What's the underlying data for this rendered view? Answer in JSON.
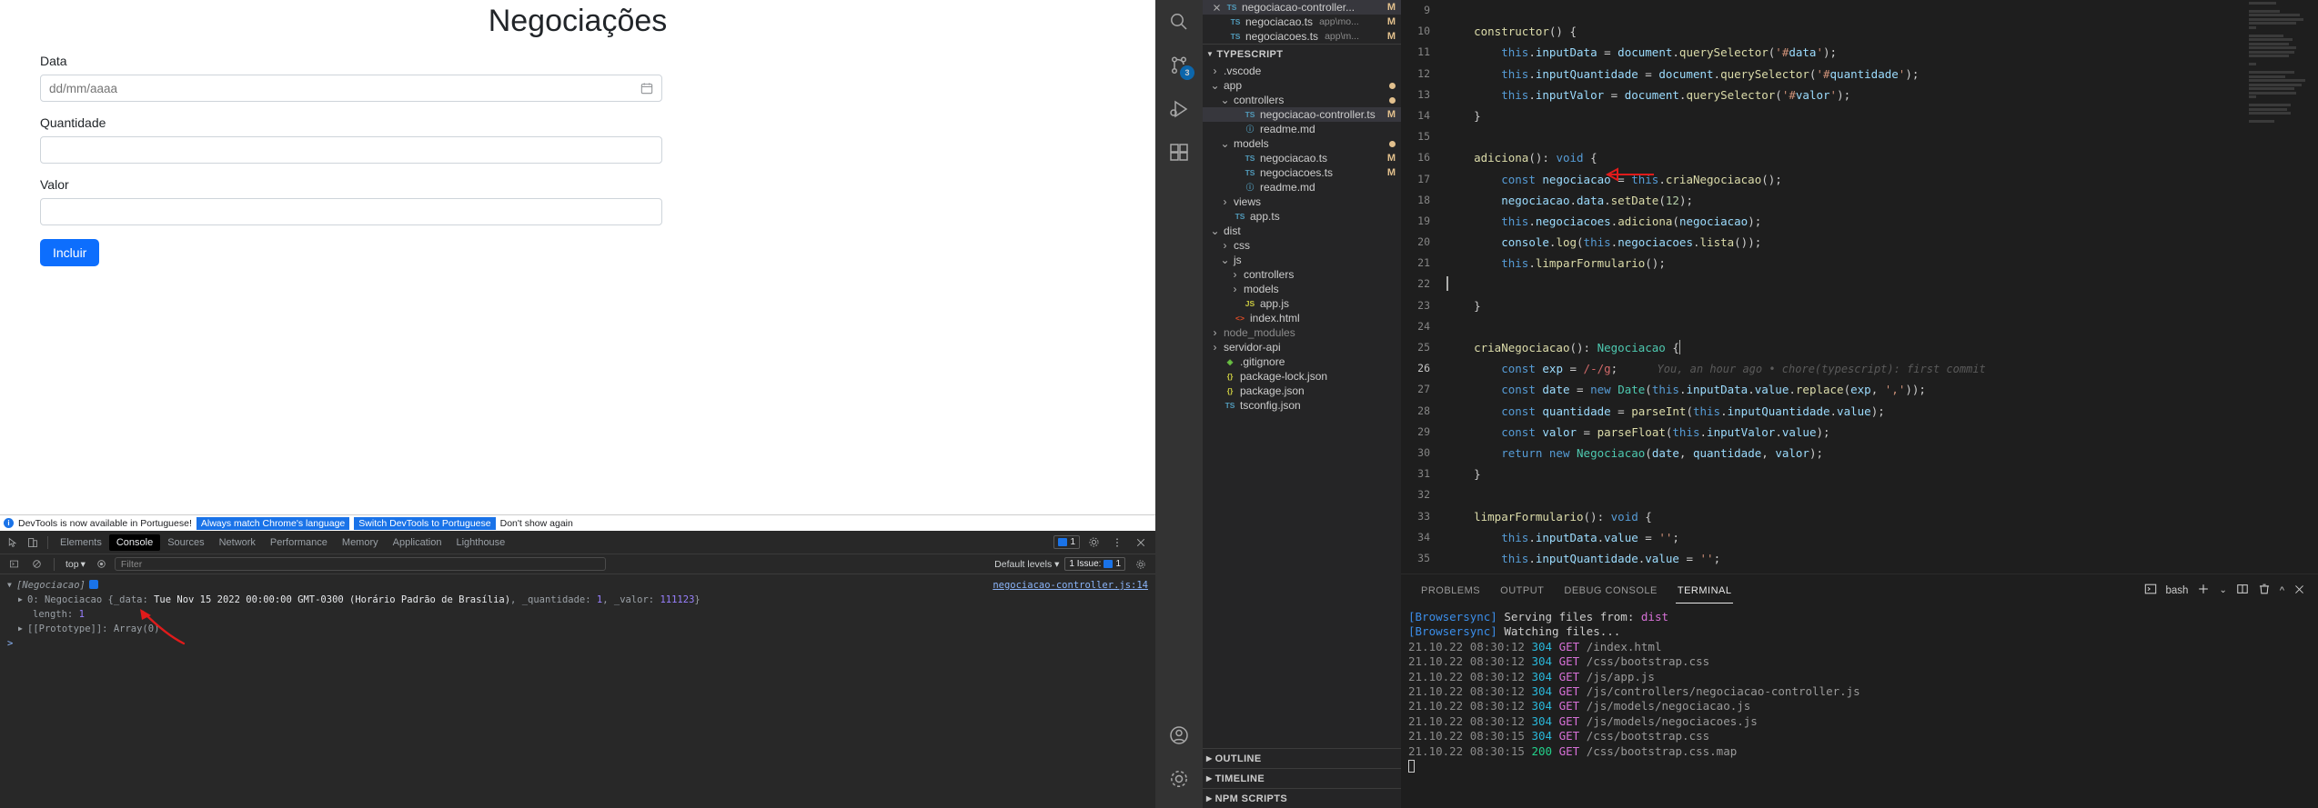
{
  "browser": {
    "page": {
      "title": "Negociações",
      "fields": [
        {
          "label": "Data",
          "placeholder": "dd/mm/aaaa",
          "value": "",
          "icon": "calendar-icon"
        },
        {
          "label": "Quantidade",
          "placeholder": "",
          "value": "",
          "icon": ""
        },
        {
          "label": "Valor",
          "placeholder": "",
          "value": "",
          "icon": ""
        }
      ],
      "submit_label": "Incluir",
      "accent_color": "#0d6efd"
    },
    "devtools_banner": {
      "message": "DevTools is now available in Portuguese!",
      "buttons": [
        "Always match Chrome's language",
        "Switch DevTools to Portuguese"
      ],
      "dismiss": "Don't show again"
    },
    "devtools": {
      "tabs": [
        "Elements",
        "Console",
        "Sources",
        "Network",
        "Performance",
        "Memory",
        "Application",
        "Lighthouse"
      ],
      "active_tab": "Console",
      "top_right_badge_count": "1",
      "filterbar": {
        "context": "top",
        "filter_placeholder": "Filter",
        "levels": "Default levels",
        "issues_label": "1 Issue:",
        "issues_count": "1"
      },
      "console": {
        "array_label": "[Negociacao]",
        "entry_index": "0:",
        "entry_class": "Negociacao",
        "entry_body": "{_data: Tue Nov 15 2022 00:00:00 GMT-0300 (Horário Padrão de Brasília), _quantidade: 1, _valor: 111123}",
        "date_value": "Tue Nov 15 2022 00:00:00 GMT-0300 (Horário Padrão de Brasília)",
        "quantidade_key": "_quantidade:",
        "quantidade_value": "1",
        "valor_key": "_valor:",
        "valor_value": "111123",
        "length_key": "length:",
        "length_value": "1",
        "prototype_row": "[[Prototype]]: Array(0)",
        "source_link": "negociacao-controller.js:14",
        "prompt": ">"
      }
    }
  },
  "vscode": {
    "activitybar": [
      {
        "name": "search-icon",
        "badge": ""
      },
      {
        "name": "source-control-icon",
        "badge": "3"
      },
      {
        "name": "run-debug-icon",
        "badge": ""
      },
      {
        "name": "extensions-icon",
        "badge": ""
      },
      {
        "name": "account-icon",
        "badge": ""
      },
      {
        "name": "settings-gear-icon",
        "badge": ""
      }
    ],
    "open_editors": [
      {
        "icon": "ts",
        "name": "negociacao-controller...",
        "path": "",
        "status": "M",
        "selected": true,
        "close": true
      },
      {
        "icon": "ts",
        "name": "negociacao.ts",
        "path": "app\\mo...",
        "status": "M",
        "selected": false,
        "close": false
      },
      {
        "icon": "ts",
        "name": "negociacoes.ts",
        "path": "app\\m...",
        "status": "M",
        "selected": false,
        "close": false
      }
    ],
    "explorer_section": "TYPESCRIPT",
    "tree": [
      {
        "depth": 0,
        "chev": "right",
        "icon": "",
        "name": ".vscode",
        "status": "",
        "dot": false,
        "dim": false,
        "selected": false
      },
      {
        "depth": 0,
        "chev": "down",
        "icon": "",
        "name": "app",
        "status": "",
        "dot": true,
        "dim": false,
        "selected": false
      },
      {
        "depth": 1,
        "chev": "down",
        "icon": "",
        "name": "controllers",
        "status": "",
        "dot": true,
        "dim": false,
        "selected": false
      },
      {
        "depth": 2,
        "chev": "none",
        "icon": "ts",
        "name": "negociacao-controller.ts",
        "status": "M",
        "dot": false,
        "dim": false,
        "selected": true
      },
      {
        "depth": 2,
        "chev": "none",
        "icon": "md",
        "name": "readme.md",
        "status": "",
        "dot": false,
        "dim": false,
        "selected": false
      },
      {
        "depth": 1,
        "chev": "down",
        "icon": "",
        "name": "models",
        "status": "",
        "dot": true,
        "dim": false,
        "selected": false
      },
      {
        "depth": 2,
        "chev": "none",
        "icon": "ts",
        "name": "negociacao.ts",
        "status": "M",
        "dot": false,
        "dim": false,
        "selected": false
      },
      {
        "depth": 2,
        "chev": "none",
        "icon": "ts",
        "name": "negociacoes.ts",
        "status": "M",
        "dot": false,
        "dim": false,
        "selected": false
      },
      {
        "depth": 2,
        "chev": "none",
        "icon": "md",
        "name": "readme.md",
        "status": "",
        "dot": false,
        "dim": false,
        "selected": false
      },
      {
        "depth": 1,
        "chev": "right",
        "icon": "",
        "name": "views",
        "status": "",
        "dot": false,
        "dim": false,
        "selected": false
      },
      {
        "depth": 1,
        "chev": "none",
        "icon": "ts",
        "name": "app.ts",
        "status": "",
        "dot": false,
        "dim": false,
        "selected": false
      },
      {
        "depth": 0,
        "chev": "down",
        "icon": "",
        "name": "dist",
        "status": "",
        "dot": false,
        "dim": false,
        "selected": false
      },
      {
        "depth": 1,
        "chev": "right",
        "icon": "",
        "name": "css",
        "status": "",
        "dot": false,
        "dim": false,
        "selected": false
      },
      {
        "depth": 1,
        "chev": "down",
        "icon": "",
        "name": "js",
        "status": "",
        "dot": false,
        "dim": false,
        "selected": false
      },
      {
        "depth": 2,
        "chev": "right",
        "icon": "",
        "name": "controllers",
        "status": "",
        "dot": false,
        "dim": false,
        "selected": false
      },
      {
        "depth": 2,
        "chev": "right",
        "icon": "",
        "name": "models",
        "status": "",
        "dot": false,
        "dim": false,
        "selected": false
      },
      {
        "depth": 2,
        "chev": "none",
        "icon": "js",
        "name": "app.js",
        "status": "",
        "dot": false,
        "dim": false,
        "selected": false
      },
      {
        "depth": 1,
        "chev": "none",
        "icon": "html",
        "name": "index.html",
        "status": "",
        "dot": false,
        "dim": false,
        "selected": false
      },
      {
        "depth": 0,
        "chev": "right",
        "icon": "",
        "name": "node_modules",
        "status": "",
        "dot": false,
        "dim": true,
        "selected": false
      },
      {
        "depth": 0,
        "chev": "right",
        "icon": "",
        "name": "servidor-api",
        "status": "",
        "dot": false,
        "dim": false,
        "selected": false
      },
      {
        "depth": 0,
        "chev": "none",
        "icon": "git",
        "name": ".gitignore",
        "status": "",
        "dot": false,
        "dim": false,
        "selected": false
      },
      {
        "depth": 0,
        "chev": "none",
        "icon": "json",
        "name": "package-lock.json",
        "status": "",
        "dot": false,
        "dim": false,
        "selected": false
      },
      {
        "depth": 0,
        "chev": "none",
        "icon": "json",
        "name": "package.json",
        "status": "",
        "dot": false,
        "dim": false,
        "selected": false
      },
      {
        "depth": 0,
        "chev": "none",
        "icon": "tsj",
        "name": "tsconfig.json",
        "status": "",
        "dot": false,
        "dim": false,
        "selected": false
      }
    ],
    "bottom_sections": [
      "OUTLINE",
      "TIMELINE",
      "NPM SCRIPTS"
    ],
    "editor": {
      "first_line_number": 9,
      "current_line": 26,
      "blame_annotation": "You, an hour ago • chore(typescript): first commit",
      "lines": [
        {
          "n": 9,
          "text": ""
        },
        {
          "n": 10,
          "text": "    constructor() {"
        },
        {
          "n": 11,
          "text": "        this.inputData = document.querySelector('#data');"
        },
        {
          "n": 12,
          "text": "        this.inputQuantidade = document.querySelector('#quantidade');"
        },
        {
          "n": 13,
          "text": "        this.inputValor = document.querySelector('#valor');"
        },
        {
          "n": 14,
          "text": "    }"
        },
        {
          "n": 15,
          "text": ""
        },
        {
          "n": 16,
          "text": "    adiciona(): void {"
        },
        {
          "n": 17,
          "text": "        const negociacao = this.criaNegociacao();"
        },
        {
          "n": 18,
          "text": "        negociacao.data.setDate(12);"
        },
        {
          "n": 19,
          "text": "        this.negociacoes.adiciona(negociacao);"
        },
        {
          "n": 20,
          "text": "        console.log(this.negociacoes.lista());"
        },
        {
          "n": 21,
          "text": "        this.limparFormulario();"
        },
        {
          "n": 22,
          "text": ""
        },
        {
          "n": 23,
          "text": "    }"
        },
        {
          "n": 24,
          "text": ""
        },
        {
          "n": 25,
          "text": "    criaNegociacao(): Negociacao {"
        },
        {
          "n": 26,
          "text": "        const exp = /-/g;"
        },
        {
          "n": 27,
          "text": "        const date = new Date(this.inputData.value.replace(exp, ','));"
        },
        {
          "n": 28,
          "text": "        const quantidade = parseInt(this.inputQuantidade.value);"
        },
        {
          "n": 29,
          "text": "        const valor = parseFloat(this.inputValor.value);"
        },
        {
          "n": 30,
          "text": "        return new Negociacao(date, quantidade, valor);"
        },
        {
          "n": 31,
          "text": "    }"
        },
        {
          "n": 32,
          "text": ""
        },
        {
          "n": 33,
          "text": "    limparFormulario(): void {"
        },
        {
          "n": 34,
          "text": "        this.inputData.value = '';"
        },
        {
          "n": 35,
          "text": "        this.inputQuantidade.value = '';"
        }
      ]
    },
    "panel": {
      "tabs": [
        "PROBLEMS",
        "OUTPUT",
        "DEBUG CONSOLE",
        "TERMINAL"
      ],
      "active_tab": "TERMINAL",
      "shell": "bash",
      "actions": [
        "new-terminal-icon",
        "split-terminal-icon",
        "kill-terminal-icon",
        "maximize-panel-icon",
        "close-panel-icon"
      ],
      "terminal_lines": [
        {
          "type": "bs",
          "tag": "[Browsersync]",
          "text": " Serving files from: ",
          "highlight": "dist"
        },
        {
          "type": "bs",
          "tag": "[Browsersync]",
          "text": " Watching files...",
          "highlight": ""
        },
        {
          "type": "req",
          "time": "21.10.22 08:30:12",
          "status": "304",
          "method": "GET",
          "path": "/index.html"
        },
        {
          "type": "req",
          "time": "21.10.22 08:30:12",
          "status": "304",
          "method": "GET",
          "path": "/css/bootstrap.css"
        },
        {
          "type": "req",
          "time": "21.10.22 08:30:12",
          "status": "304",
          "method": "GET",
          "path": "/js/app.js"
        },
        {
          "type": "req",
          "time": "21.10.22 08:30:12",
          "status": "304",
          "method": "GET",
          "path": "/js/controllers/negociacao-controller.js"
        },
        {
          "type": "req",
          "time": "21.10.22 08:30:12",
          "status": "304",
          "method": "GET",
          "path": "/js/models/negociacao.js"
        },
        {
          "type": "req",
          "time": "21.10.22 08:30:12",
          "status": "304",
          "method": "GET",
          "path": "/js/models/negociacoes.js"
        },
        {
          "type": "req",
          "time": "21.10.22 08:30:15",
          "status": "304",
          "method": "GET",
          "path": "/css/bootstrap.css"
        },
        {
          "type": "req",
          "time": "21.10.22 08:30:15",
          "status": "200",
          "method": "GET",
          "path": "/css/bootstrap.css.map"
        }
      ]
    }
  }
}
